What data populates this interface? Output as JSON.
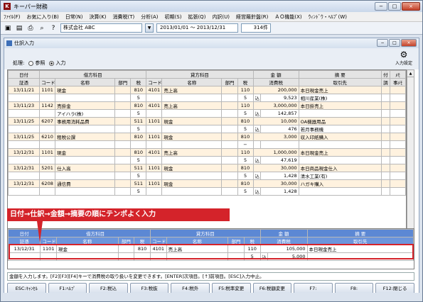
{
  "app": {
    "title": "キーパー財務",
    "menus": [
      "ﾌｧｲﾙ(F)",
      "お気に入り(B)",
      "日常(N)",
      "決算(K)",
      "消費税(T)",
      "分析(A)",
      "初期(S)",
      "拡張(Q)",
      "内訳(U)",
      "経営羅針盤(R)",
      "ＡＯ機能(X)",
      "ｳｨﾝﾄﾞｳ・ﾍﾙﾌﾟ(W)"
    ],
    "company": "株式会社 ABC",
    "period": "2013/01/01 〜 2013/12/31",
    "count": "314件"
  },
  "child": {
    "title": "仕訳入力",
    "process_label": "処理:",
    "radio_view": "参照",
    "radio_input": "入力",
    "input_settings": "入力設定"
  },
  "grid": {
    "h1": [
      "日付",
      "借方科目",
      "貸方科目",
      "金 額",
      "摘 要",
      "付",
      "ﾒﾓ"
    ],
    "h2": [
      "証憑",
      "コード",
      "名称",
      "部門",
      "税",
      "コード",
      "名称",
      "部門",
      "税",
      "消費税",
      "取引先",
      "調",
      "事ﾒﾓ"
    ],
    "rows": [
      {
        "date": "13/11/21",
        "dc": "1101",
        "dn": "現金",
        "dt": "810",
        "cc": "4101",
        "cn": "売上高",
        "ct": "110",
        "amt": "200,000",
        "memo": "本日現金売上",
        "tax_t": "5",
        "tax_k": "込",
        "tax": "9,523",
        "memo2": "相川産業(株)"
      },
      {
        "date": "13/11/23",
        "dc": "1142",
        "dn": "売掛金",
        "dt": "810",
        "cc": "4101",
        "cn": "売上高",
        "ct": "110",
        "amt": "3,000,000",
        "memo": "本日掛売上",
        "tax_t": "5",
        "tax_k": "込",
        "tax": "142,857",
        "memo2": "",
        "dn2": "アイハラ(株)"
      },
      {
        "date": "13/11/25",
        "dc": "6207",
        "dn": "事務用消耗品費",
        "dt": "511",
        "cc": "1101",
        "cn": "現金",
        "ct": "810",
        "amt": "10,000",
        "memo": "OA機器用品",
        "tax_t": "5",
        "tax_k": "込",
        "tax": "476",
        "memo2": "若月事務機"
      },
      {
        "date": "13/11/25",
        "dc": "6210",
        "dn": "租税公課",
        "dt": "810",
        "cc": "1101",
        "cn": "現金",
        "ct": "810",
        "amt": "3,000",
        "memo": "収入印紙購入",
        "tax_t": "",
        "tax_k": "",
        "tax": "",
        "memo2": "",
        "dash": "−"
      },
      {
        "date": "13/12/31",
        "dc": "1101",
        "dn": "現金",
        "dt": "810",
        "cc": "4101",
        "cn": "売上高",
        "ct": "110",
        "amt": "1,000,000",
        "memo": "本日現金売上",
        "tax_t": "5",
        "tax_k": "込",
        "tax": "47,619",
        "memo2": ""
      },
      {
        "date": "13/12/31",
        "dc": "5201",
        "dn": "仕入高",
        "dt": "511",
        "cc": "1101",
        "cn": "現金",
        "ct": "810",
        "amt": "30,000",
        "memo": "本日商品現金仕入",
        "tax_t": "5",
        "tax_k": "込",
        "tax": "1,428",
        "memo2": "清水工業(有)"
      },
      {
        "date": "13/12/31",
        "dc": "6208",
        "dn": "通信費",
        "dt": "511",
        "cc": "1101",
        "cn": "現金",
        "ct": "810",
        "amt": "30,000",
        "memo": "ハガキ購入",
        "tax_t": "5",
        "tax_k": "込",
        "tax": "1,428",
        "memo2": ""
      }
    ]
  },
  "callout": "日付→仕訳→金額→摘要の順にテンポよく入力",
  "entry": {
    "date": "13/12/31",
    "dc": "1101",
    "dn": "現金",
    "dt": "810",
    "cc": "4101",
    "cn": "売上高",
    "ct": "110",
    "amt": "105,000",
    "memo": "本日現金売上",
    "tax_t": "5",
    "tax_k": "込",
    "tax": "5,000"
  },
  "status": "金額を入力します。[F2][F3][F4]キーで消費税の取り扱いを変更できます。[ENTER]次項目。[↑]前項目。[ESC]入力中止。",
  "fkeys": [
    "ESC:ｷｬﾝｾﾙ",
    "F1:ﾍﾙﾌﾟ",
    "F2:税込",
    "F3:税抜",
    "F4:税外",
    "F5:税率変更",
    "F6:税額変更",
    "F7:",
    "F8:",
    "F12:閉じる"
  ],
  "colors": {
    "accent_red": "#d4232a",
    "row_highlight": "#fff2df",
    "entry_header": "#5c88d4"
  }
}
